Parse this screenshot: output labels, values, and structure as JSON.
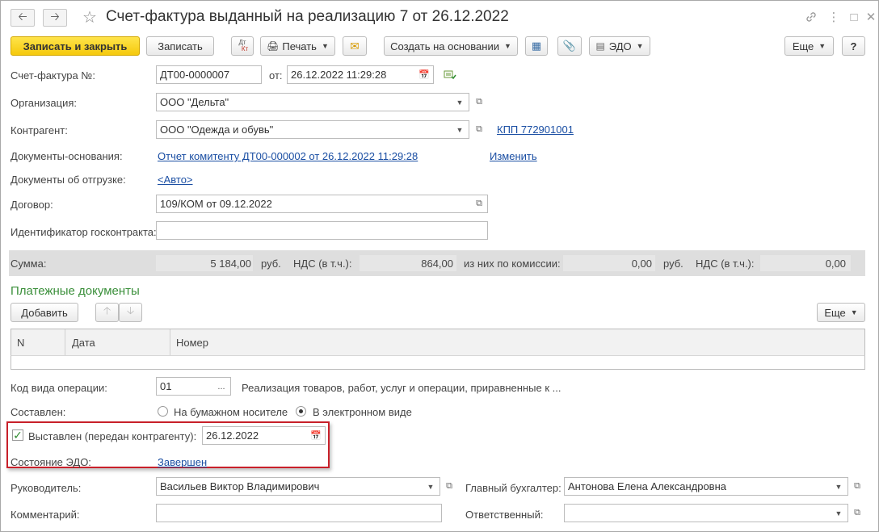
{
  "window": {
    "title": "Счет-фактура выданный на реализацию 7 от 26.12.2022"
  },
  "toolbar": {
    "save_close": "Записать и закрыть",
    "save": "Записать",
    "dtkt_top": "Дт",
    "dtkt_bottom": "Кт",
    "print": "Печать",
    "create_based": "Создать на основании",
    "edo": "ЭДО",
    "more": "Еще",
    "help": "?"
  },
  "form": {
    "invoice_no_label": "Счет-фактура №:",
    "invoice_no": "ДТ00-0000007",
    "from_label": "от:",
    "date": "26.12.2022 11:29:28",
    "org_label": "Организация:",
    "org": "ООО \"Дельта\"",
    "contractor_label": "Контрагент:",
    "contractor": "ООО \"Одежда и обувь\"",
    "kpp_link": "КПП 772901001",
    "base_docs_label": "Документы-основания:",
    "base_docs_link": "Отчет комитенту ДТ00-000002 от 26.12.2022 11:29:28",
    "change_link": "Изменить",
    "shipment_docs_label": "Документы об отгрузке:",
    "shipment_docs_link": "<Авто>",
    "contract_label": "Договор:",
    "contract": "109/КОМ от 09.12.2022",
    "gov_id_label": "Идентификатор госконтракта:",
    "gov_id": ""
  },
  "sums": {
    "sum_label": "Сумма:",
    "sum_value": "5 184,00",
    "currency1": "руб.",
    "vat_label1": "НДС (в т.ч.):",
    "vat_value1": "864,00",
    "commission_label": "из них по комиссии:",
    "commission_value": "0,00",
    "currency2": "руб.",
    "vat_label2": "НДС (в т.ч.):",
    "vat_value2": "0,00"
  },
  "payments": {
    "section_title": "Платежные документы",
    "add_button": "Добавить",
    "more": "Еще",
    "columns": [
      "N",
      "Дата",
      "Номер"
    ]
  },
  "bottom": {
    "op_code_label": "Код вида операции:",
    "op_code": "01",
    "op_code_btn": "...",
    "op_code_desc": "Реализация товаров, работ, услуг и операции, приравненные к ...",
    "composed_label": "Составлен:",
    "radio_paper": "На бумажном носителе",
    "radio_electronic": "В электронном виде",
    "issued_label": "Выставлен (передан контрагенту):",
    "issued_date": "26.12.2022",
    "edo_state_label": "Состояние ЭДО:",
    "edo_state_link": "Завершен",
    "director_label": "Руководитель:",
    "director": "Васильев Виктор Владимирович",
    "chief_acc_label": "Главный бухгалтер:",
    "chief_acc": "Антонова Елена Александровна",
    "comment_label": "Комментарий:",
    "comment": "",
    "responsible_label": "Ответственный:",
    "responsible": ""
  }
}
